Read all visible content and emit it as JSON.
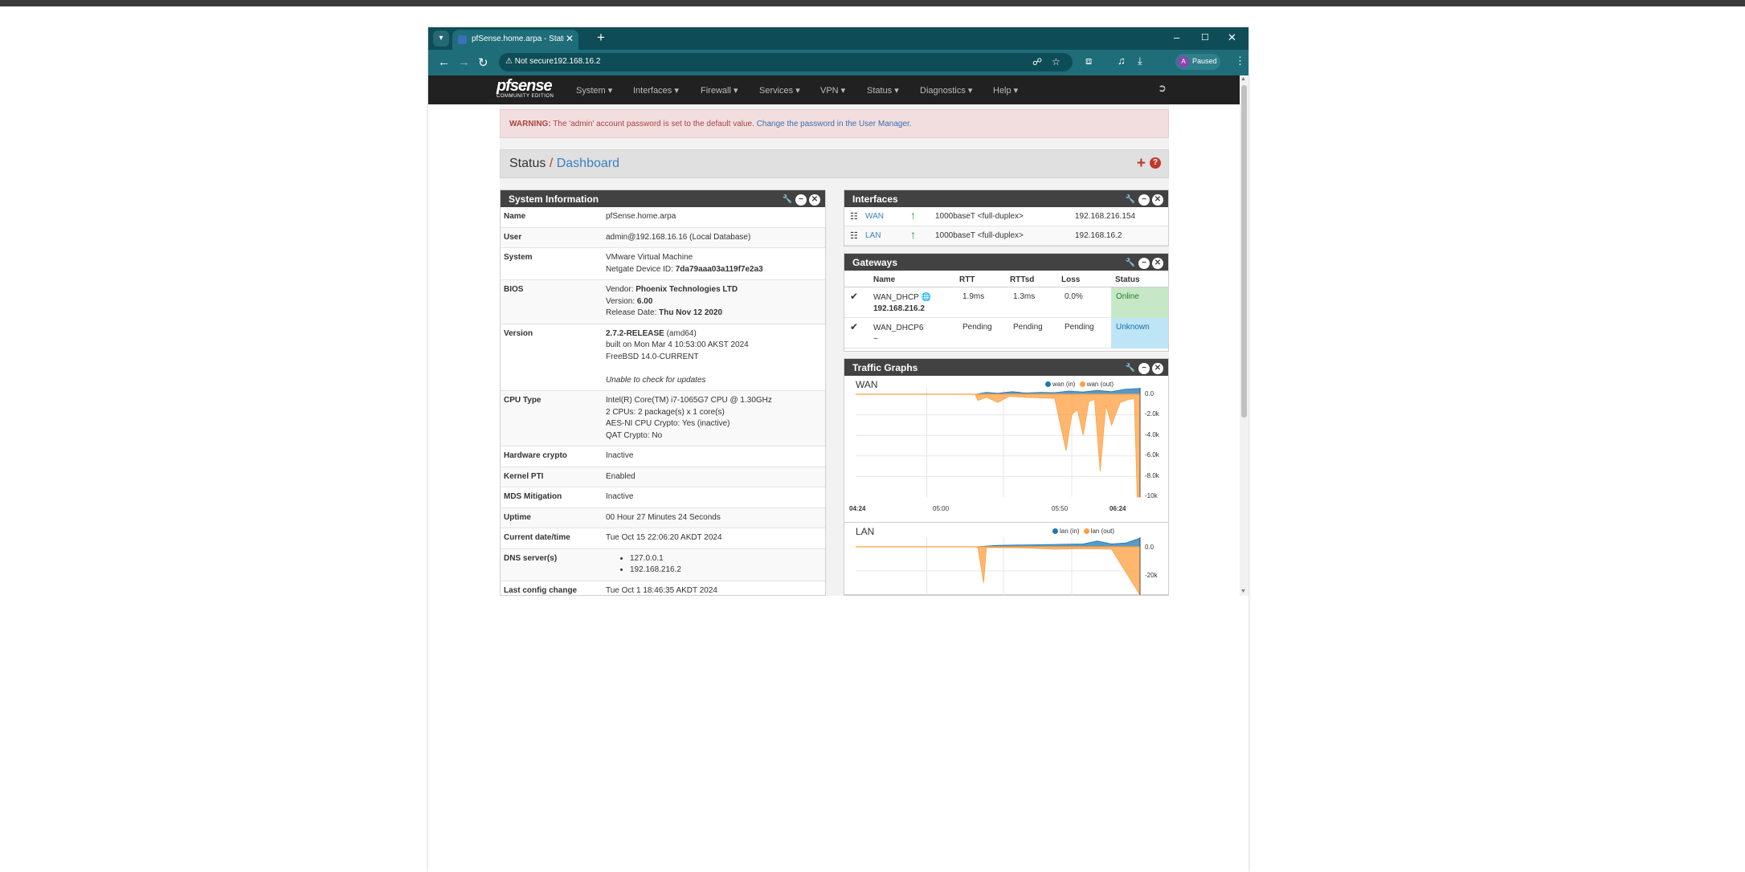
{
  "browser": {
    "tab_title": "pfSense.home.arpa - Status: Dashboard",
    "new_tab": "+",
    "not_secure": "Not secure",
    "url": "192.168.16.2",
    "profile_initial": "A",
    "profile_status": "Paused"
  },
  "nav": {
    "logo": "pfsense",
    "logo_sub": "COMMUNITY EDITION",
    "menu": [
      "System",
      "Interfaces",
      "Firewall",
      "Services",
      "VPN",
      "Status",
      "Diagnostics",
      "Help"
    ]
  },
  "warning": {
    "label": "WARNING:",
    "text": " The 'admin' account password is set to the default value. ",
    "link": "Change the password in the User Manager."
  },
  "breadcrumb": {
    "parent": "Status",
    "sep": "/",
    "current": "Dashboard"
  },
  "system_info": {
    "title": "System Information",
    "name_label": "Name",
    "name": "pfSense.home.arpa",
    "user_label": "User",
    "user": "admin@192.168.16.16 (Local Database)",
    "system_label": "System",
    "system_line1": "VMware Virtual Machine",
    "system_line2_label": "Netgate Device ID: ",
    "system_device_id": "7da79aaa03a119f7e2a3",
    "bios_label": "BIOS",
    "bios_vendor_label": "Vendor: ",
    "bios_vendor": "Phoenix Technologies LTD",
    "bios_version_label": "Version: ",
    "bios_version": "6.00",
    "bios_date_label": "Release Date: ",
    "bios_date": "Thu Nov 12 2020",
    "version_label": "Version",
    "version_release": "2.7.2-RELEASE",
    "version_arch": " (amd64)",
    "version_built": "built on Mon Mar 4 10:53:00 AKST 2024",
    "version_os": "FreeBSD 14.0-CURRENT",
    "version_update": "Unable to check for updates",
    "cpu_label": "CPU Type",
    "cpu_line1": "Intel(R) Core(TM) i7-1065G7 CPU @ 1.30GHz",
    "cpu_line2": "2 CPUs: 2 package(s) x 1 core(s)",
    "cpu_line3": "AES-NI CPU Crypto: Yes (inactive)",
    "cpu_line4": "QAT Crypto: No",
    "hwcrypto_label": "Hardware crypto",
    "hwcrypto": "Inactive",
    "pti_label": "Kernel PTI",
    "pti": "Enabled",
    "mds_label": "MDS Mitigation",
    "mds": "Inactive",
    "uptime_label": "Uptime",
    "uptime": "00 Hour 27 Minutes 24 Seconds",
    "datetime_label": "Current date/time",
    "datetime": "Tue Oct 15 22:06:20 AKDT 2024",
    "dns_label": "DNS server(s)",
    "dns1": "127.0.0.1",
    "dns2": "192.168.216.2",
    "lastcfg_label": "Last config change",
    "lastcfg": "Tue Oct 1 18:46:35 AKDT 2024"
  },
  "interfaces": {
    "title": "Interfaces",
    "rows": [
      {
        "name": "WAN",
        "media": "1000baseT <full-duplex>",
        "ip": "192.168.216.154"
      },
      {
        "name": "LAN",
        "media": "1000baseT <full-duplex>",
        "ip": "192.168.16.2"
      }
    ]
  },
  "gateways": {
    "title": "Gateways",
    "headers": {
      "name": "Name",
      "rtt": "RTT",
      "rttsd": "RTTsd",
      "loss": "Loss",
      "status": "Status"
    },
    "rows": [
      {
        "name": "WAN_DHCP",
        "ip": "192.168.216.2",
        "rtt": "1.9ms",
        "rttsd": "1.3ms",
        "loss": "0.0%",
        "status": "Online"
      },
      {
        "name": "WAN_DHCP6",
        "ip": "~",
        "rtt": "Pending",
        "rttsd": "Pending",
        "loss": "Pending",
        "status": "Unknown"
      }
    ]
  },
  "traffic": {
    "title": "Traffic Graphs",
    "colors": {
      "in": "#1f77b4",
      "out": "#ff9f40"
    },
    "wan": {
      "title": "WAN",
      "legend_in": "wan (in)",
      "legend_out": "wan (out)",
      "y_ticks": [
        "0.0",
        "-2.0k",
        "-4.0k",
        "-6.0k",
        "-8.0k",
        "-10k"
      ],
      "x_ticks": [
        "04:24",
        "05:00",
        "05:50",
        "06:24"
      ]
    },
    "lan": {
      "title": "LAN",
      "legend_in": "lan (in)",
      "legend_out": "lan (out)",
      "y_ticks": [
        "0.0",
        "-20k"
      ]
    }
  },
  "chart_data": [
    {
      "type": "area",
      "title": "WAN",
      "series": [
        {
          "name": "wan (in)",
          "points": [
            [
              0.0,
              0
            ],
            [
              0.42,
              0
            ],
            [
              0.46,
              300
            ],
            [
              0.5,
              150
            ],
            [
              0.55,
              400
            ],
            [
              0.6,
              200
            ],
            [
              0.65,
              300
            ],
            [
              0.7,
              250
            ],
            [
              0.75,
              500
            ],
            [
              0.8,
              350
            ],
            [
              0.85,
              600
            ],
            [
              0.9,
              400
            ],
            [
              0.95,
              800
            ],
            [
              1.0,
              900
            ]
          ]
        },
        {
          "name": "wan (out)",
          "points": [
            [
              0.0,
              0
            ],
            [
              0.42,
              0
            ],
            [
              0.43,
              -600
            ],
            [
              0.46,
              -300
            ],
            [
              0.5,
              -800
            ],
            [
              0.54,
              -200
            ],
            [
              0.6,
              -300
            ],
            [
              0.7,
              -400
            ],
            [
              0.72,
              -3000
            ],
            [
              0.74,
              -5500
            ],
            [
              0.76,
              -2000
            ],
            [
              0.78,
              -1500
            ],
            [
              0.8,
              -4000
            ],
            [
              0.82,
              -700
            ],
            [
              0.84,
              -500
            ],
            [
              0.86,
              -7500
            ],
            [
              0.88,
              -1000
            ],
            [
              0.9,
              -3000
            ],
            [
              0.93,
              -800
            ],
            [
              0.96,
              -500
            ],
            [
              0.98,
              -400
            ],
            [
              0.99,
              -10000
            ],
            [
              1.0,
              -10000
            ]
          ]
        }
      ],
      "ylim": [
        -10000,
        0
      ]
    },
    {
      "type": "area",
      "title": "LAN",
      "series": [
        {
          "name": "lan (in)",
          "points": [
            [
              0.0,
              0
            ],
            [
              0.42,
              0
            ],
            [
              0.5,
              1500
            ],
            [
              0.6,
              2000
            ],
            [
              0.7,
              2500
            ],
            [
              0.8,
              3000
            ],
            [
              0.85,
              6000
            ],
            [
              0.9,
              3000
            ],
            [
              0.95,
              4000
            ],
            [
              1.0,
              9000
            ]
          ]
        },
        {
          "name": "lan (out)",
          "points": [
            [
              0.0,
              0
            ],
            [
              0.42,
              0
            ],
            [
              0.43,
              -500
            ],
            [
              0.45,
              -30000
            ],
            [
              0.46,
              -500
            ],
            [
              0.6,
              -1000
            ],
            [
              0.7,
              -2000
            ],
            [
              0.8,
              -1500
            ],
            [
              0.9,
              -2000
            ],
            [
              1.0,
              -40000
            ]
          ]
        }
      ]
    }
  ]
}
